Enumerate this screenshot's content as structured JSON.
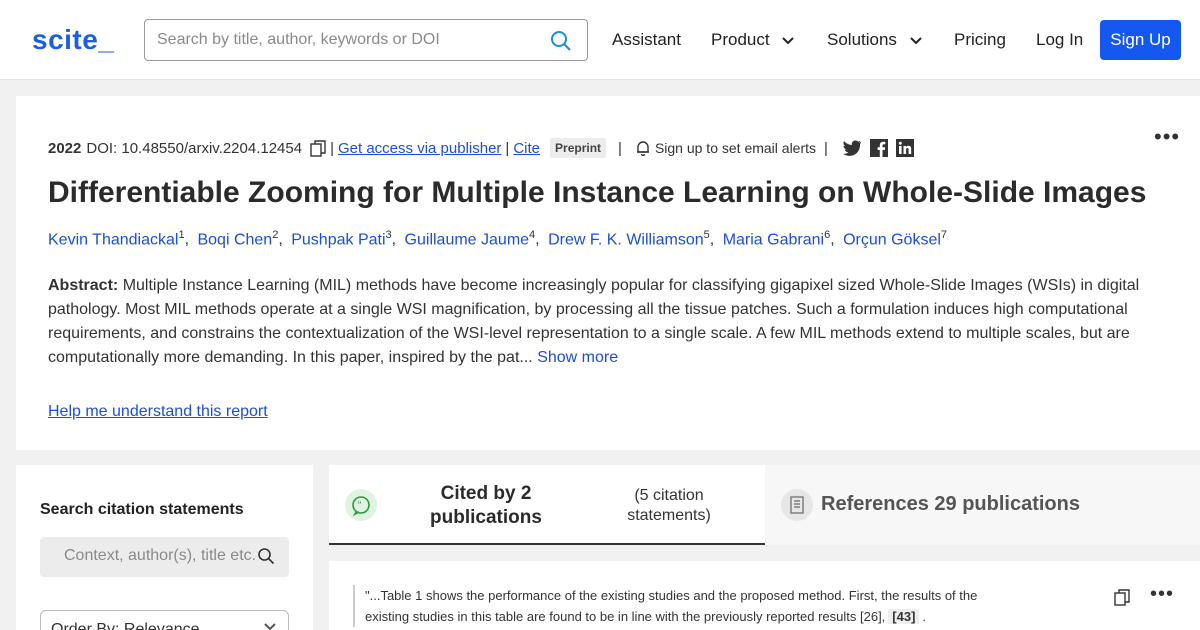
{
  "brand": {
    "logo": "scite_"
  },
  "search": {
    "placeholder": "Search by title, author, keywords or DOI"
  },
  "nav": {
    "assistant": "Assistant",
    "product": "Product",
    "solutions": "Solutions",
    "pricing": "Pricing",
    "login": "Log In",
    "signup": "Sign Up"
  },
  "paper": {
    "year": "2022",
    "doi": "DOI: 10.48550/arxiv.2204.12454",
    "access_link": "Get access via publisher",
    "cite_link": "Cite",
    "badge": "Preprint",
    "alerts": "Sign up to set email alerts",
    "title": "Differentiable Zooming for Multiple Instance Learning on Whole-Slide Images",
    "authors": [
      {
        "name": "Kevin Thandiackal",
        "sup": "1"
      },
      {
        "name": "Boqi Chen",
        "sup": "2"
      },
      {
        "name": "Pushpak Pati",
        "sup": "3"
      },
      {
        "name": "Guillaume Jaume",
        "sup": "4"
      },
      {
        "name": "Drew F. K. Williamson",
        "sup": "5"
      },
      {
        "name": "Maria Gabrani",
        "sup": "6"
      },
      {
        "name": "Orçun Göksel",
        "sup": "7"
      }
    ],
    "abstract_label": "Abstract:",
    "abstract_text": "Multiple Instance Learning (MIL) methods have become increasingly popular for classifying gigapixel sized Whole-Slide Images (WSIs) in digital pathology. Most MIL methods operate at a single WSI magnification, by processing all the tissue patches. Such a formulation induces high computational requirements, and constrains the contextualization of the WSI-level representation to a single scale. A few MIL methods extend to multiple scales, but are computationally more demanding. In this paper, inspired by the pat...",
    "show_more": "Show more",
    "help_link": "Help me understand this report"
  },
  "sidebar": {
    "heading": "Search citation statements",
    "context_placeholder": "Context, author(s), title etc.",
    "order_by": "Order By: Relevance"
  },
  "tabs": {
    "cited_main": "Cited by 2 publications",
    "cited_sub": "(5 citation statements)",
    "references": "References 29 publications"
  },
  "citation": {
    "text_before": "\"...Table 1 shows the performance of the existing studies and the proposed method. First, the results of the existing studies in this table are found to be in line with the previously reported results [26],",
    "ref": "[43]",
    "text_after": "."
  }
}
